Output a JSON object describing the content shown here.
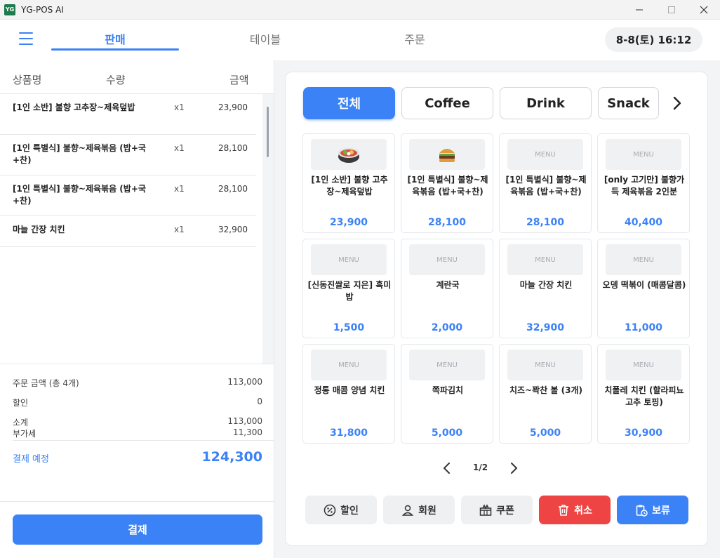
{
  "window": {
    "title": "YG-POS AI",
    "icon_text": "YG"
  },
  "nav": {
    "tabs": [
      {
        "label": "판매",
        "active": true
      },
      {
        "label": "테이블",
        "active": false
      },
      {
        "label": "주문",
        "active": false
      }
    ],
    "datetime": "8-8(토) 16:12"
  },
  "order_list": {
    "headers": {
      "name": "상품명",
      "qty": "수량",
      "amount": "금액"
    },
    "items": [
      {
        "name": "[1인 소반] 불향 고추장~제육덮밥",
        "qty": "x1",
        "amount": "23,900"
      },
      {
        "name": "[1인 특별식] 불향~제육볶음 (밥+국+찬)",
        "qty": "x1",
        "amount": "28,100"
      },
      {
        "name": "[1인 특별식] 불향~제육볶음 (밥+국+찬)",
        "qty": "x1",
        "amount": "28,100"
      },
      {
        "name": "마늘 간장 치킨",
        "qty": "x1",
        "amount": "32,900"
      }
    ]
  },
  "summary": {
    "order_amount_label": "주문 금액 (총 4개)",
    "order_amount": "113,000",
    "discount_label": "할인",
    "discount": "0",
    "subtotal_label": "소계",
    "subtotal": "113,000",
    "vat_label": "부가세",
    "vat": "11,300",
    "payment_label": "결제 예정",
    "payment_total": "124,300",
    "pay_button": "결제"
  },
  "categories": [
    {
      "label": "전체",
      "active": true
    },
    {
      "label": "Coffee",
      "active": false
    },
    {
      "label": "Drink",
      "active": false
    },
    {
      "label": "Snack",
      "active": false
    }
  ],
  "products": [
    {
      "name": "[1인 소반] 불향 고추장~제육덮밥",
      "price": "23,900",
      "thumb": "bibimbap-icon"
    },
    {
      "name": "[1인 특별식] 불향~제육볶음 (밥+국+찬)",
      "price": "28,100",
      "thumb": "burger-icon"
    },
    {
      "name": "[1인 특별식] 불향~제육볶음 (밥+국+찬)",
      "price": "28,100",
      "thumb": "MENU"
    },
    {
      "name": "[only 고기만] 불향가득 제육볶음 2인분",
      "price": "40,400",
      "thumb": "MENU"
    },
    {
      "name": "[신동진쌀로 지은] 흑미밥",
      "price": "1,500",
      "thumb": "MENU"
    },
    {
      "name": "계란국",
      "price": "2,000",
      "thumb": "MENU"
    },
    {
      "name": "마늘 간장 치킨",
      "price": "32,900",
      "thumb": "MENU"
    },
    {
      "name": "오뎅 떡볶이 (매콤달콤)",
      "price": "11,000",
      "thumb": "MENU"
    },
    {
      "name": "정통 매콤 양념 치킨",
      "price": "31,800",
      "thumb": "MENU"
    },
    {
      "name": "쪽파김치",
      "price": "5,000",
      "thumb": "MENU"
    },
    {
      "name": "치즈~꽉찬 볼 (3개)",
      "price": "5,000",
      "thumb": "MENU"
    },
    {
      "name": "치폴레 치킨 (할라피뇨고추 토핑)",
      "price": "30,900",
      "thumb": "MENU"
    }
  ],
  "pagination": {
    "label": "1/2"
  },
  "actions": {
    "discount": "할인",
    "member": "회원",
    "coupon": "쿠폰",
    "cancel": "취소",
    "hold": "보류"
  },
  "colors": {
    "accent": "#3b82f6",
    "danger": "#ef4444"
  }
}
